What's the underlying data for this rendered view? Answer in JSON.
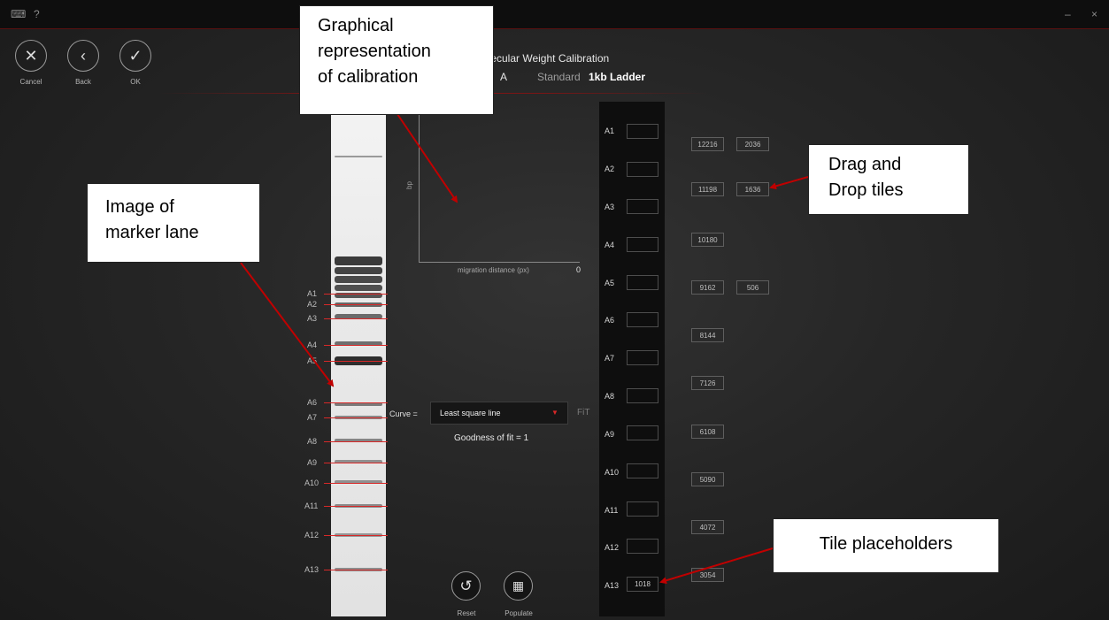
{
  "titlebar": {
    "keyboard_icon": "keyboard-icon",
    "help": "?",
    "minimize": "–",
    "close": "×"
  },
  "toolbar": {
    "cancel_label": "Cancel",
    "back_label": "Back",
    "ok_label": "OK"
  },
  "header": {
    "title": "Molecular Weight Calibration",
    "lane": "A",
    "standard_label": "Standard",
    "standard_value": "1kb Ladder"
  },
  "lane_markers": [
    "A1",
    "A2",
    "A3",
    "A4",
    "A5",
    "A6",
    "A7",
    "A8",
    "A9",
    "A10",
    "A11",
    "A12",
    "A13"
  ],
  "chart": {
    "ylabel": "bp",
    "xlabel": "migration distance (px)",
    "x_value": "0"
  },
  "curve": {
    "label": "Curve =",
    "selected": "Least square line",
    "fit_label": "FiT",
    "goodness_of_fit": "Goodness of fit = 1"
  },
  "slots": [
    {
      "label": "A1",
      "value": ""
    },
    {
      "label": "A2",
      "value": ""
    },
    {
      "label": "A3",
      "value": ""
    },
    {
      "label": "A4",
      "value": ""
    },
    {
      "label": "A5",
      "value": ""
    },
    {
      "label": "A6",
      "value": ""
    },
    {
      "label": "A7",
      "value": ""
    },
    {
      "label": "A8",
      "value": ""
    },
    {
      "label": "A9",
      "value": ""
    },
    {
      "label": "A10",
      "value": ""
    },
    {
      "label": "A11",
      "value": ""
    },
    {
      "label": "A12",
      "value": ""
    },
    {
      "label": "A13",
      "value": "1018"
    }
  ],
  "tiles_col1": [
    "12216",
    "11198",
    "10180",
    "9162",
    "8144",
    "7126",
    "6108",
    "5090",
    "4072",
    "3054"
  ],
  "tiles_col2": [
    "2036",
    "1636",
    "506"
  ],
  "bottom_buttons": {
    "reset_label": "Reset",
    "populate_label": "Populate"
  },
  "callouts": {
    "graph_line1": "Graphical",
    "graph_line2": "representation",
    "graph_line3": "of calibration",
    "marker_line1": "Image of",
    "marker_line2": "marker lane",
    "tiles_line1": "Drag and",
    "tiles_line2": "Drop tiles",
    "placeholders": "Tile placeholders"
  },
  "colors": {
    "accent": "#d72828",
    "background": "#262626",
    "annotation_arrow": "#c00000"
  }
}
